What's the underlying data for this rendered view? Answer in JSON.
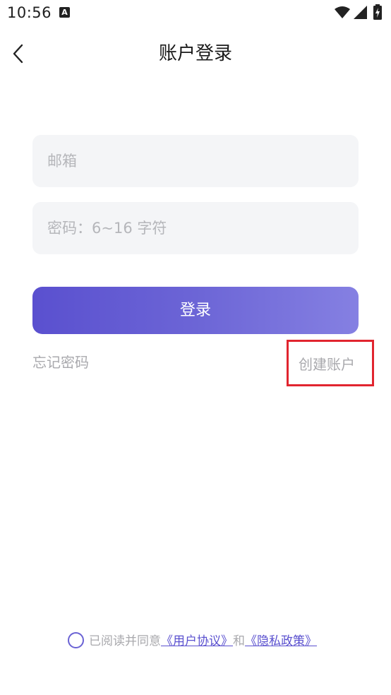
{
  "status_bar": {
    "time": "10:56",
    "notification_icon": "a-icon",
    "icons": [
      "wifi-icon",
      "signal-icon",
      "battery-icon"
    ]
  },
  "header": {
    "back_icon": "chevron-left-icon",
    "title": "账户登录"
  },
  "form": {
    "email_placeholder": "邮箱",
    "email_value": "",
    "password_placeholder": "密码：6~16 字符",
    "password_value": "",
    "login_label": "登录"
  },
  "links": {
    "forgot_password": "忘记密码",
    "create_account": "创建账户"
  },
  "agreement": {
    "checked": false,
    "prefix": "已阅读并同意",
    "user_agreement": "《用户协议》",
    "and": "和",
    "privacy_policy": "《隐私政策》"
  },
  "colors": {
    "accent": "#5a50cf",
    "accent_light": "#8580e2",
    "input_bg": "#f4f5f7",
    "muted_text": "#a9a9ad",
    "highlight_border": "#e1252f"
  }
}
